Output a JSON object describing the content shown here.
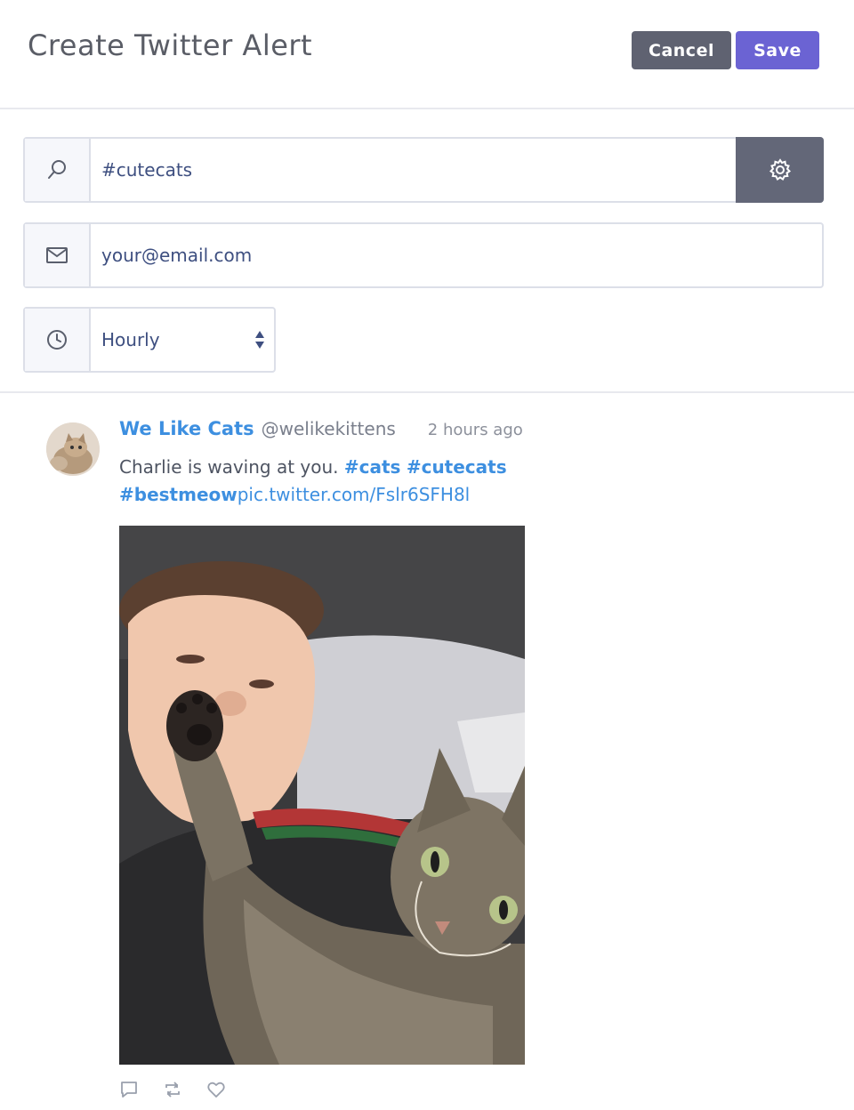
{
  "header": {
    "title": "Create Twitter Alert",
    "cancel_label": "Cancel",
    "save_label": "Save"
  },
  "form": {
    "search_value": "#cutecats",
    "email_value": "your@email.com",
    "frequency_value": "Hourly",
    "icons": [
      "search-icon",
      "mail-icon",
      "clock-icon",
      "gear-icon",
      "select-arrows-icon"
    ]
  },
  "tweet": {
    "name": "We Like Cats",
    "handle": "@welikekittens",
    "time": "2 hours ago",
    "text_prefix": "Charlie is waving at you. ",
    "tag1": "#cats",
    "tag2": "#cutecats",
    "tag3": "#bestmeow",
    "link": "pic.twitter.com/Fslr6SFH8l",
    "actions": [
      "reply-icon",
      "retweet-icon",
      "like-icon"
    ]
  },
  "colors": {
    "accent": "#6b63d3",
    "cancel": "#5f6271",
    "link": "#3d8fe0"
  }
}
